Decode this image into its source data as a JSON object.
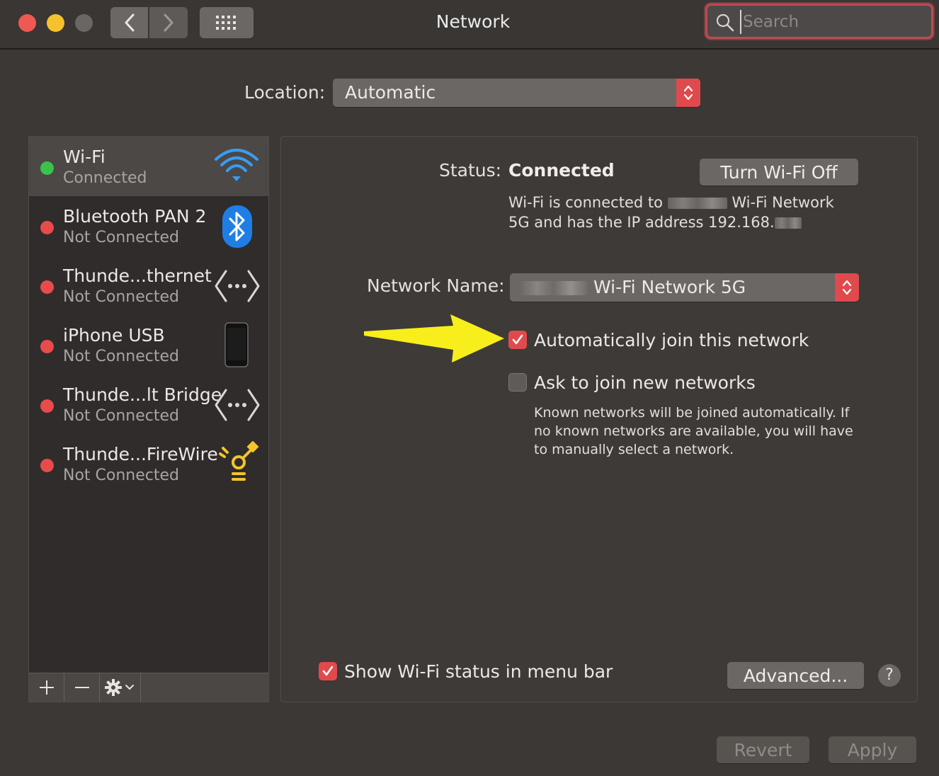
{
  "window": {
    "title": "Network",
    "search_placeholder": "Search"
  },
  "location": {
    "label": "Location:",
    "value": "Automatic"
  },
  "services": [
    {
      "name": "Wi-Fi",
      "status": "Connected",
      "dot_color": "#3ac34a",
      "icon": "wifi-icon"
    },
    {
      "name": "Bluetooth PAN 2",
      "status": "Not Connected",
      "dot_color": "#e94b4b",
      "icon": "bluetooth-icon"
    },
    {
      "name": "Thunde...thernet",
      "status": "Not Connected",
      "dot_color": "#e94b4b",
      "icon": "ethernet-arrows-icon"
    },
    {
      "name": "iPhone USB",
      "status": "Not Connected",
      "dot_color": "#e94b4b",
      "icon": "iphone-icon"
    },
    {
      "name": "Thunde...lt Bridge",
      "status": "Not Connected",
      "dot_color": "#e94b4b",
      "icon": "bridge-arrows-icon"
    },
    {
      "name": "Thunde...FireWire",
      "status": "Not Connected",
      "dot_color": "#e94b4b",
      "icon": "firewire-icon"
    }
  ],
  "detail": {
    "status_label": "Status:",
    "status_value": "Connected",
    "turn_off_button": "Turn Wi-Fi Off",
    "desc_part1": "Wi-Fi is connected to",
    "desc_part2": "Wi-Fi Network 5G and has the IP address 192.168.",
    "network_name_label": "Network Name:",
    "network_name_value": "Wi-Fi Network 5G",
    "auto_join_label": "Automatically join this network",
    "auto_join_checked": true,
    "ask_join_label": "Ask to join new networks",
    "ask_join_checked": false,
    "ask_join_help": "Known networks will be joined automatically. If no known networks are available, you will have to manually select a network.",
    "show_status_label": "Show Wi-Fi status in menu bar",
    "show_status_checked": true,
    "advanced_button": "Advanced...",
    "help_button": "?"
  },
  "footer": {
    "revert_button": "Revert",
    "apply_button": "Apply"
  },
  "colors": {
    "accent": "#e04a4c",
    "arrow": "#f7ee1b"
  }
}
